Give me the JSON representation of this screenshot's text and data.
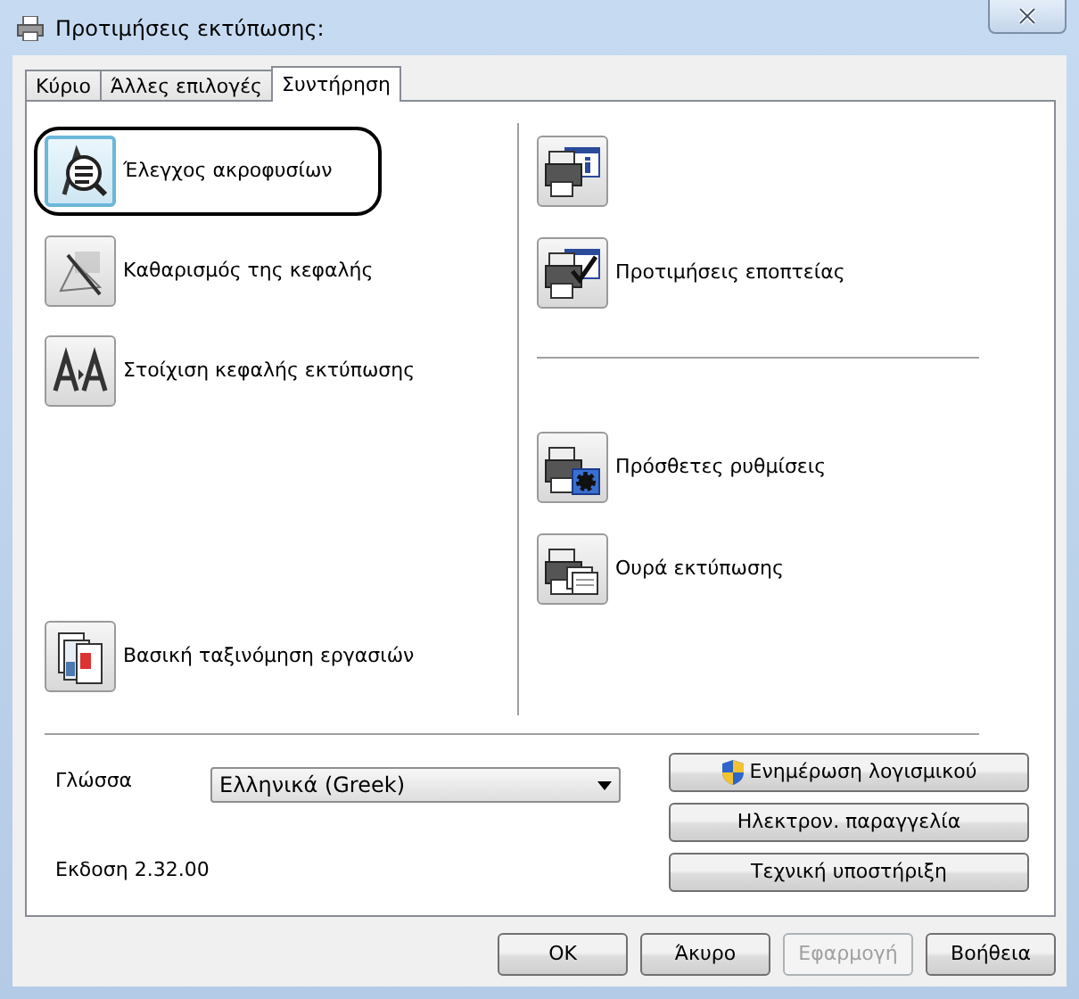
{
  "window": {
    "title": "Προτιμήσεις εκτύπωσης:"
  },
  "tabs": [
    {
      "label": "Κύριο",
      "selected": false
    },
    {
      "label": "Άλλες επιλογές",
      "selected": false
    },
    {
      "label": "Συντήρηση",
      "selected": true
    }
  ],
  "left_tools": [
    {
      "kind": "check",
      "label": "Έλεγχος ακροφυσίων",
      "highlighted": true
    },
    {
      "kind": "clean",
      "label": "Καθαρισμός της κεφαλής",
      "highlighted": false
    },
    {
      "kind": "align",
      "label": "Στοίχιση κεφαλής εκτύπωσης",
      "highlighted": false
    },
    {
      "kind": "sort",
      "label": "Βασική ταξινόμηση εργασιών",
      "highlighted": false
    }
  ],
  "right_groups": [
    [
      {
        "kind": "info",
        "highlighted": false
      },
      {
        "kind": "monitor",
        "label": "Προτιμήσεις εποπτείας",
        "highlighted": false
      }
    ],
    [
      {
        "kind": "settings",
        "label": "Πρόσθετες ρυθμίσεις",
        "highlighted": false
      },
      {
        "kind": "queue",
        "label": "Ουρά εκτύπωσης",
        "highlighted": false
      }
    ]
  ],
  "language": {
    "label": "Γλώσσα",
    "value": "Ελληνικά (Greek)"
  },
  "version": "Εκδοση 2.32.00",
  "side_buttons": [
    {
      "label": "Ενημέρωση λογισμικού",
      "shield": true
    },
    {
      "label": "Ηλεκτρον. παραγγελία",
      "shield": false
    },
    {
      "label": "Τεχνική υποστήριξη",
      "shield": false
    }
  ],
  "dialog_buttons": [
    {
      "label": "OK",
      "disabled": false
    },
    {
      "label": "Άκυρο",
      "disabled": false
    },
    {
      "label": "Εφαρμογή",
      "disabled": true
    },
    {
      "label": "Βοήθεια",
      "disabled": false
    }
  ]
}
